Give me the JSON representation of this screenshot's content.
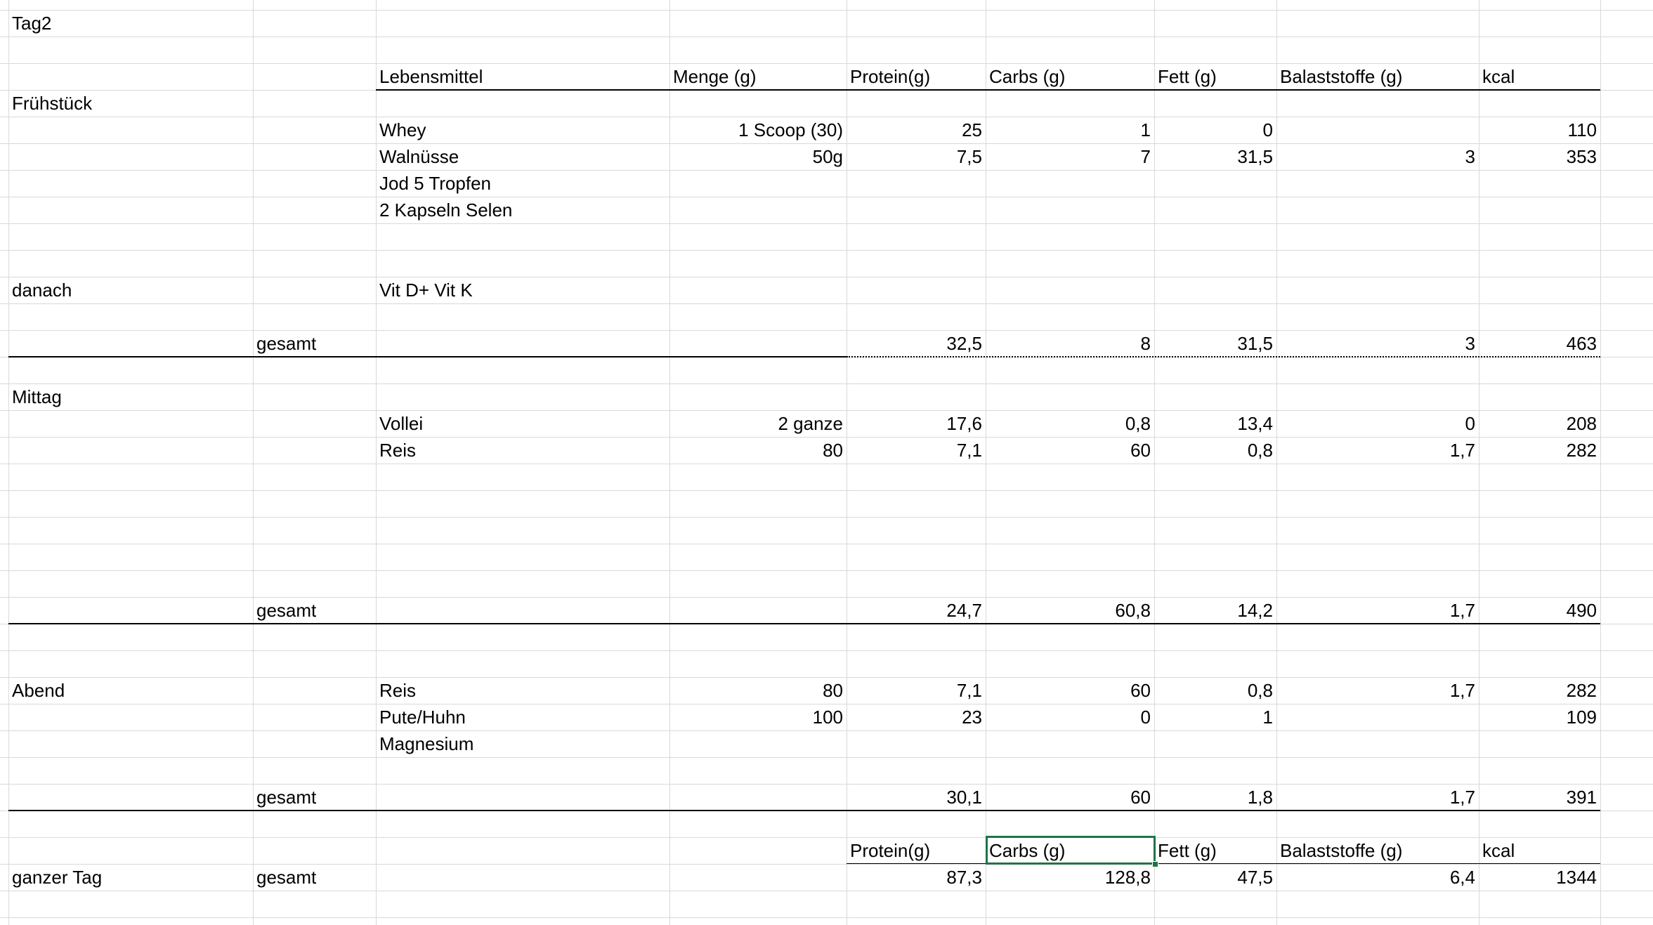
{
  "sheet": {
    "title": "Tag2",
    "header": {
      "food": "Lebensmittel",
      "amount": "Menge (g)",
      "protein": "Protein(g)",
      "carbs": "Carbs (g)",
      "fat": "Fett (g)",
      "fiber": "Balaststoffe (g)",
      "kcal": "kcal"
    },
    "sections": {
      "breakfast": "Frühstück",
      "after": "danach",
      "lunch": "Mittag",
      "dinner": "Abend",
      "whole_day": "ganzer Tag"
    },
    "total_label": "gesamt",
    "breakfast_items": [
      {
        "food": "Whey",
        "amount": "1 Scoop (30)",
        "protein": "25",
        "carbs": "1",
        "fat": "0",
        "fiber": "",
        "kcal": "110"
      },
      {
        "food": "Walnüsse",
        "amount": "50g",
        "protein": "7,5",
        "carbs": "7",
        "fat": "31,5",
        "fiber": "3",
        "kcal": "353"
      },
      {
        "food": "Jod 5 Tropfen",
        "amount": "",
        "protein": "",
        "carbs": "",
        "fat": "",
        "fiber": "",
        "kcal": ""
      },
      {
        "food": "2 Kapseln Selen",
        "amount": "",
        "protein": "",
        "carbs": "",
        "fat": "",
        "fiber": "",
        "kcal": ""
      }
    ],
    "after_item": "Vit D+ Vit K",
    "breakfast_total": {
      "protein": "32,5",
      "carbs": "8",
      "fat": "31,5",
      "fiber": "3",
      "kcal": "463"
    },
    "lunch_items": [
      {
        "food": "Vollei",
        "amount": "2 ganze",
        "protein": "17,6",
        "carbs": "0,8",
        "fat": "13,4",
        "fiber": "0",
        "kcal": "208"
      },
      {
        "food": "Reis",
        "amount": "80",
        "protein": "7,1",
        "carbs": "60",
        "fat": "0,8",
        "fiber": "1,7",
        "kcal": "282"
      }
    ],
    "lunch_total": {
      "protein": "24,7",
      "carbs": "60,8",
      "fat": "14,2",
      "fiber": "1,7",
      "kcal": "490"
    },
    "dinner_items": [
      {
        "food": "Reis",
        "amount": "80",
        "protein": "7,1",
        "carbs": "60",
        "fat": "0,8",
        "fiber": "1,7",
        "kcal": "282"
      },
      {
        "food": "Pute/Huhn",
        "amount": "100",
        "protein": "23",
        "carbs": "0",
        "fat": "1",
        "fiber": "",
        "kcal": "109"
      },
      {
        "food": "Magnesium",
        "amount": "",
        "protein": "",
        "carbs": "",
        "fat": "",
        "fiber": "",
        "kcal": ""
      }
    ],
    "dinner_total": {
      "protein": "30,1",
      "carbs": "60",
      "fat": "1,8",
      "fiber": "1,7",
      "kcal": "391"
    },
    "day_header": {
      "protein": "Protein(g)",
      "carbs": "Carbs (g)",
      "fat": "Fett (g)",
      "fiber": "Balaststoffe (g)",
      "kcal": "kcal"
    },
    "day_total": {
      "protein": "87,3",
      "carbs": "128,8",
      "fat": "47,5",
      "fiber": "6,4",
      "kcal": "1344"
    }
  },
  "colors": {
    "gridline": "#d9d9d9",
    "border": "#000000",
    "selection": "#217346"
  }
}
